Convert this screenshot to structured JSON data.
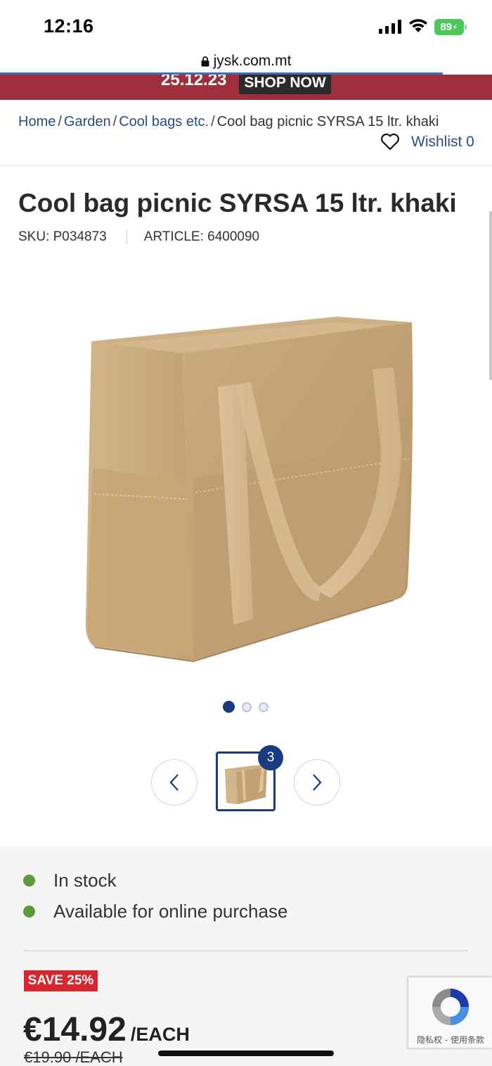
{
  "status_bar": {
    "time": "12:16",
    "battery": "89"
  },
  "browser": {
    "url": "jysk.com.mt"
  },
  "promo": {
    "date": "25.12.23",
    "button_label": "SHOP NOW"
  },
  "breadcrumb": {
    "items": [
      "Home",
      "Garden",
      "Cool bags etc."
    ],
    "separator": "/",
    "current": "Cool bag picnic SYRSA 15 ltr. khaki"
  },
  "wishlist": {
    "label": "Wishlist 0"
  },
  "product": {
    "title": "Cool bag picnic SYRSA 15 ltr. khaki",
    "sku": "SKU: P034873",
    "article": "ARTICLE: 6400090",
    "image_icon": "cool-bag-image",
    "image_count_badge": "3",
    "gallery": {
      "total_dots": 3,
      "active_index": 0
    }
  },
  "availability": {
    "items": [
      "In stock",
      "Available for online purchase"
    ],
    "indicator_color": "#5d9a3b"
  },
  "pricing": {
    "save_badge": "SAVE 25%",
    "price": "€14.92",
    "unit": "/EACH",
    "old_price": "€19.90 /EACH"
  },
  "recaptcha": {
    "footer": "隐私权 - 使用条款"
  },
  "colors": {
    "brand_blue": "#1a3a82",
    "promo_red": "#9f2f3c",
    "sale_red": "#d7262f",
    "link_blue": "#274c8a"
  }
}
